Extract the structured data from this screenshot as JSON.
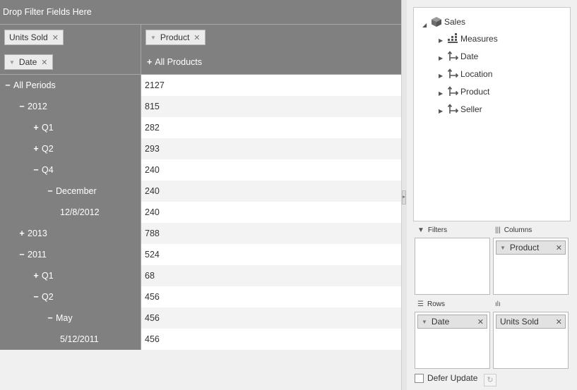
{
  "pivot": {
    "drop_filter_text": "Drop Filter Fields Here",
    "data_field_chip": "Units Sold",
    "column_field_chip": "Product",
    "row_field_chip": "Date",
    "column_header": "All Products",
    "rows": [
      {
        "label": "All Periods",
        "sign": "−",
        "value": "2127"
      },
      {
        "label": "2012",
        "sign": "−",
        "value": "815"
      },
      {
        "label": "Q1",
        "sign": "+",
        "value": "282"
      },
      {
        "label": "Q2",
        "sign": "+",
        "value": "293"
      },
      {
        "label": "Q4",
        "sign": "−",
        "value": "240"
      },
      {
        "label": "December",
        "sign": "−",
        "value": "240"
      },
      {
        "label": "12/8/2012",
        "sign": "",
        "value": "240"
      },
      {
        "label": "2013",
        "sign": "+",
        "value": "788"
      },
      {
        "label": "2011",
        "sign": "−",
        "value": "524"
      },
      {
        "label": "Q1",
        "sign": "+",
        "value": "68"
      },
      {
        "label": "Q2",
        "sign": "−",
        "value": "456"
      },
      {
        "label": "May",
        "sign": "−",
        "value": "456"
      },
      {
        "label": "5/12/2011",
        "sign": "",
        "value": "456"
      }
    ]
  },
  "fieldlist": {
    "root": "Sales",
    "nodes": [
      "Measures",
      "Date",
      "Location",
      "Product",
      "Seller"
    ],
    "filters_label": "Filters",
    "columns_label": "Columns",
    "rows_label": "Rows",
    "columns_chip": "Product",
    "rows_chip": "Date",
    "values_chip": "Units Sold",
    "defer_label": "Defer Update"
  },
  "icons": [
    "close-icon",
    "dropdown-arrow-icon",
    "expand-icon",
    "collapse-icon",
    "cube-icon",
    "hierarchy-icon",
    "measures-icon",
    "filter-icon",
    "columns-icon",
    "rows-icon",
    "values-icon",
    "refresh-icon",
    "checkbox-icon",
    "tree-expand-icon"
  ]
}
